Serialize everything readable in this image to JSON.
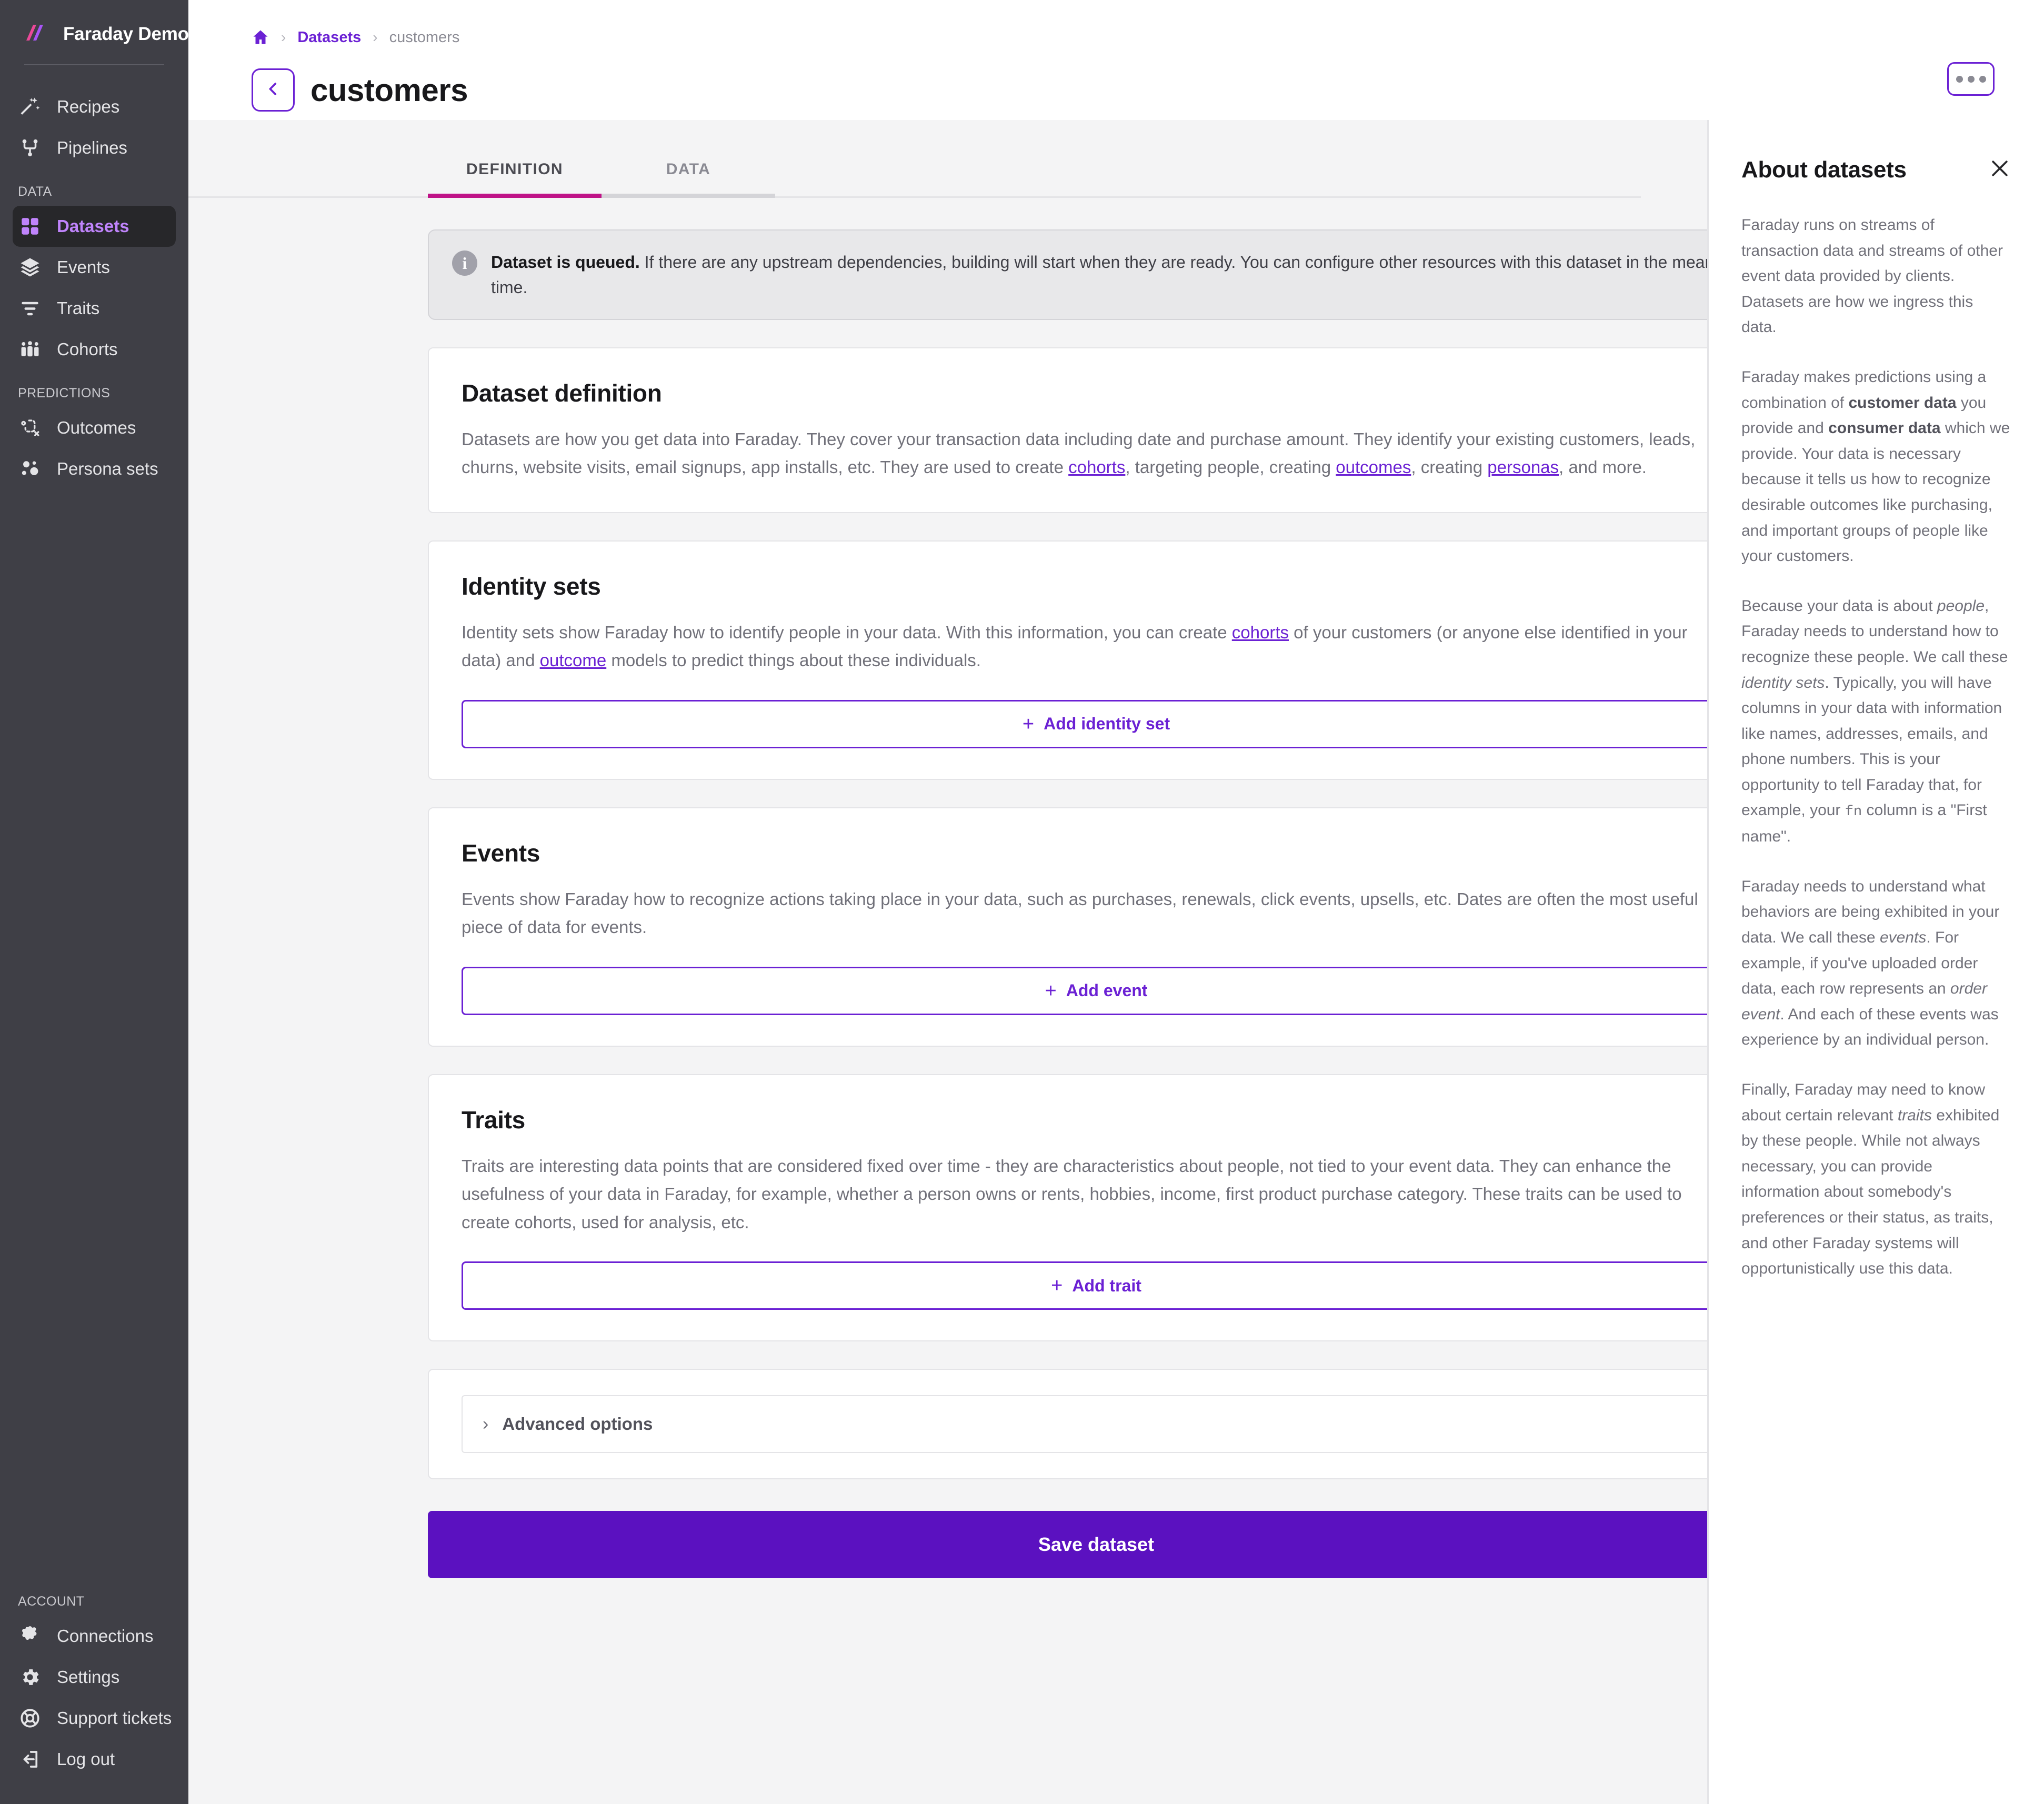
{
  "brand": {
    "name": "Faraday Demo",
    "logo_icon": "faraday-logo-icon"
  },
  "sidebar": {
    "top_items": [
      {
        "label": "Recipes",
        "icon": "magic-wand-icon"
      },
      {
        "label": "Pipelines",
        "icon": "pipeline-branch-icon"
      }
    ],
    "data_section_label": "DATA",
    "data_items": [
      {
        "label": "Datasets",
        "icon": "grid-squares-icon",
        "active": true
      },
      {
        "label": "Events",
        "icon": "layers-icon",
        "active": false
      },
      {
        "label": "Traits",
        "icon": "filter-lines-icon",
        "active": false
      },
      {
        "label": "Cohorts",
        "icon": "people-group-icon",
        "active": false
      }
    ],
    "predictions_section_label": "PREDICTIONS",
    "predictions_items": [
      {
        "label": "Outcomes",
        "icon": "outcome-path-icon"
      },
      {
        "label": "Persona sets",
        "icon": "persona-dots-icon"
      }
    ],
    "account_section_label": "ACCOUNT",
    "account_items": [
      {
        "label": "Connections",
        "icon": "puzzle-piece-icon"
      },
      {
        "label": "Settings",
        "icon": "gear-icon"
      },
      {
        "label": "Support tickets",
        "icon": "lifebuoy-icon"
      },
      {
        "label": "Log out",
        "icon": "logout-arrow-icon"
      }
    ]
  },
  "topbar": {
    "breadcrumb": {
      "home_icon": "home-icon",
      "separator": "›",
      "datasets_label": "Datasets",
      "current_label": "customers"
    },
    "back_button_icon": "chevron-left-icon",
    "page_title": "customers",
    "more_button_icon": "ellipsis-icon"
  },
  "tabs": [
    {
      "label": "DEFINITION",
      "active": true
    },
    {
      "label": "DATA",
      "active": false
    }
  ],
  "alert": {
    "icon": "info-icon",
    "bold_prefix": "Dataset is queued.",
    "text": " If there are any upstream dependencies, building will start when they are ready. You can configure other resources with this dataset in the mean time."
  },
  "sections": {
    "dataset_definition": {
      "heading": "Dataset definition",
      "text_part1": "Datasets are how you get data into Faraday. They cover your transaction data including date and purchase amount. They identify your existing customers, leads, churns, website visits, email signups, app installs, etc. They are used to create ",
      "link_cohorts": "cohorts",
      "text_part2": ", targeting people, creating ",
      "link_outcomes": "outcomes",
      "text_part3": ", creating ",
      "link_personas": "personas",
      "text_part4": ", and more."
    },
    "identity_sets": {
      "heading": "Identity sets",
      "text_part1": "Identity sets show Faraday how to identify people in your data. With this information, you can create ",
      "link_cohorts": "cohorts",
      "text_part2": " of your customers (or anyone else identified in your data) and ",
      "link_outcome": "outcome",
      "text_part3": " models to predict things about these individuals.",
      "button_label": "Add identity set",
      "button_plus": "+"
    },
    "events": {
      "heading": "Events",
      "text": "Events show Faraday how to recognize actions taking place in your data, such as purchases, renewals, click events, upsells, etc. Dates are often the most useful piece of data for events.",
      "button_label": "Add event",
      "button_plus": "+"
    },
    "traits": {
      "heading": "Traits",
      "text": "Traits are interesting data points that are considered fixed over time - they are characteristics about people, not tied to your event data. They can enhance the usefulness of your data in Faraday, for example, whether a person owns or rents, hobbies, income, first product purchase category. These traits can be used to create cohorts, used for analysis, etc.",
      "button_label": "Add trait",
      "button_plus": "+"
    },
    "advanced": {
      "label": "Advanced options",
      "chevron": "›"
    },
    "save_button_label": "Save dataset"
  },
  "right_panel": {
    "title": "About datasets",
    "close_icon": "close-icon",
    "p1": "Faraday runs on streams of transaction data and streams of other event data provided by clients. Datasets are how we ingress this data.",
    "p2_a": "Faraday makes predictions using a combination of ",
    "p2_b1": "customer data",
    "p2_c": " you provide and ",
    "p2_b2": "consumer data",
    "p2_d": " which we provide. Your data is necessary because it tells us how to recognize desirable outcomes like purchasing, and important groups of people like your customers.",
    "p3_a": "Because your data is about ",
    "p3_i1": "people",
    "p3_b": ", Faraday needs to understand how to recognize these people. We call these ",
    "p3_i2": "identity sets",
    "p3_c": ". Typically, you will have columns in your data with information like names, addresses, emails, and phone numbers. This is your opportunity to tell Faraday that, for example, your ",
    "p3_mono": "fn",
    "p3_d": " column is a \"First name\".",
    "p4_a": "Faraday needs to understand what behaviors are being exhibited in your data. We call these ",
    "p4_i1": "events",
    "p4_b": ". For example, if you've uploaded order data, each row represents an ",
    "p4_i2": "order event",
    "p4_c": ". And each of these events was experience by an individual person.",
    "p5_a": "Finally, Faraday may need to know about certain relevant ",
    "p5_i1": "traits",
    "p5_b": " exhibited by these people. While not always necessary, you can provide information about somebody's preferences or their status, as traits, and other Faraday systems will opportunistically use this data."
  },
  "colors": {
    "sidebar_bg": "#3f3f46",
    "accent_purple": "#6b21d4",
    "save_purple": "#5b11c0",
    "active_nav": "#c084fc",
    "tab_active_underline": "#bf1287"
  }
}
